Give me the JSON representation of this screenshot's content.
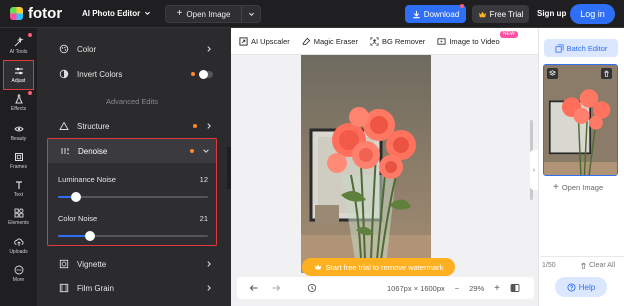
{
  "topbar": {
    "logo_text": "fotor",
    "product_name": "AI Photo Editor",
    "open_image": "Open Image",
    "download": "Download",
    "free_trial": "Free Trial",
    "sign_up": "Sign up",
    "log_in": "Log in"
  },
  "rail": [
    {
      "label": "AI Tools",
      "icon": "magic-wand-icon"
    },
    {
      "label": "Adjust",
      "icon": "sliders-icon",
      "active": true
    },
    {
      "label": "Effects",
      "icon": "flask-icon"
    },
    {
      "label": "Beauty",
      "icon": "eye-icon"
    },
    {
      "label": "Frames",
      "icon": "frame-icon"
    },
    {
      "label": "Text",
      "icon": "text-icon"
    },
    {
      "label": "Elements",
      "icon": "elements-icon"
    },
    {
      "label": "Uploads",
      "icon": "cloud-upload-icon"
    },
    {
      "label": "More",
      "icon": "more-icon"
    }
  ],
  "panel": {
    "color": "Color",
    "invert_colors": "Invert Colors",
    "advanced_edits": "Advanced Edits",
    "structure": "Structure",
    "denoise": "Denoise",
    "luminance_noise": {
      "label": "Luminance Noise",
      "value": "12",
      "level": 0.12
    },
    "color_noise": {
      "label": "Color Noise",
      "value": "21",
      "level": 0.21
    },
    "vignette": "Vignette",
    "film_grain": "Film Grain"
  },
  "canvas": {
    "tools": [
      "AI Upscaler",
      "Magic Eraser",
      "BG Remover",
      "Image to Video"
    ],
    "new_badge": "NEW",
    "watermark_cta": "Start free trial to remove watermark",
    "dimensions": "1067px × 1600px",
    "zoom": "29%"
  },
  "right": {
    "batch_editor": "Batch Editor",
    "open_image": "Open Image",
    "count": "1/50",
    "clear_all": "Clear All",
    "help": "Help"
  },
  "colors": {
    "accent": "#2f6ff5",
    "highlight_border": "#e03a3a",
    "trial_orange": "#ffb020"
  }
}
